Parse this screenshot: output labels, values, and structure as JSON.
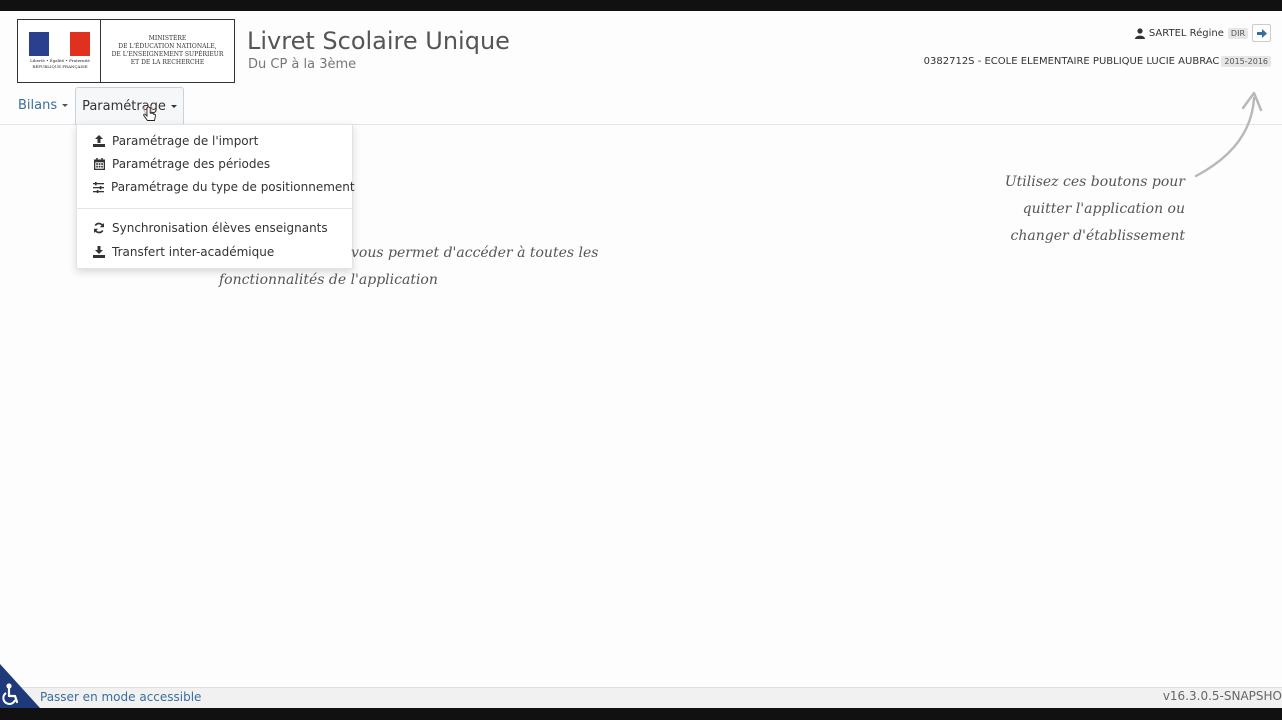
{
  "logo": {
    "motto": "Liberté • Égalité • Fraternité",
    "republic": "RÉPUBLIQUE FRANÇAISE",
    "ministry_lines": [
      "MINISTÈRE",
      "DE L'ÉDUCATION NATIONALE,",
      "DE L'ENSEIGNEMENT SUPÉRIEUR",
      "ET DE LA RECHERCHE"
    ]
  },
  "app": {
    "title": "Livret Scolaire Unique",
    "subtitle": "Du CP à la 3ème"
  },
  "user": {
    "name": "SARTEL Régine",
    "role": "DIR",
    "icon": "user-icon",
    "logout_icon": "logout-icon"
  },
  "school": {
    "name": "0382712S - ECOLE ELEMENTAIRE PUBLIQUE LUCIE AUBRAC",
    "year": "2015-2016"
  },
  "nav": {
    "items": [
      {
        "label": "Bilans"
      },
      {
        "label": "Paramétrage",
        "active": true
      }
    ]
  },
  "dropdown": {
    "items": [
      {
        "label": "Paramétrage de l'import",
        "icon": "upload-icon"
      },
      {
        "label": "Paramétrage des périodes",
        "icon": "calendar-icon"
      },
      {
        "label": "Paramétrage du type de positionnement",
        "icon": "sliders-icon"
      },
      {
        "label": "Synchronisation élèves enseignants",
        "icon": "refresh-icon"
      },
      {
        "label": "Transfert inter-académique",
        "icon": "download-icon"
      }
    ]
  },
  "annotations": {
    "left": [
      "vous permet d'accéder à toutes les",
      "fonctionnalités de l'application"
    ],
    "right": [
      "Utilisez ces boutons pour",
      "quitter l'application ou",
      "changer d'établissement"
    ]
  },
  "footer": {
    "accessible_link": "Passer en mode accessible",
    "version": "v16.3.0.5-SNAPSHO"
  },
  "colors": {
    "link": "#3a6d9c",
    "flag_blue": "#2b3f8f",
    "flag_red": "#e0301e",
    "accessibility_blue": "#1f3a7a"
  }
}
